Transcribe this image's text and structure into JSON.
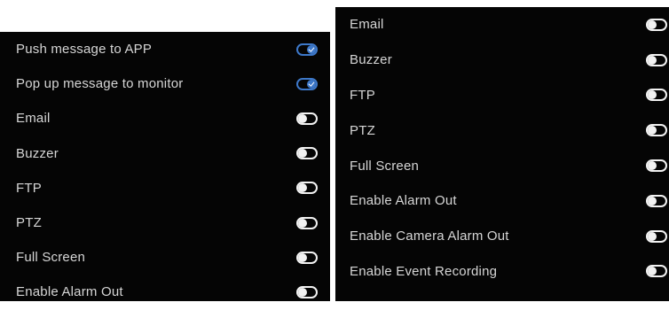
{
  "left_panel": {
    "items": [
      {
        "label": "Push message to APP",
        "enabled": true
      },
      {
        "label": "Pop up message to monitor",
        "enabled": true
      },
      {
        "label": "Email",
        "enabled": false
      },
      {
        "label": "Buzzer",
        "enabled": false
      },
      {
        "label": "FTP",
        "enabled": false
      },
      {
        "label": "PTZ",
        "enabled": false
      },
      {
        "label": "Full Screen",
        "enabled": false
      },
      {
        "label": "Enable Alarm Out",
        "enabled": false
      }
    ]
  },
  "right_panel": {
    "items": [
      {
        "label": "Email",
        "enabled": false
      },
      {
        "label": "Buzzer",
        "enabled": false
      },
      {
        "label": "FTP",
        "enabled": false
      },
      {
        "label": "PTZ",
        "enabled": false
      },
      {
        "label": "Full Screen",
        "enabled": false
      },
      {
        "label": "Enable Alarm Out",
        "enabled": false
      },
      {
        "label": "Enable Camera Alarm Out",
        "enabled": false
      },
      {
        "label": "Enable Event Recording",
        "enabled": false
      }
    ]
  },
  "colors": {
    "panel_background": "#050505",
    "text": "#d6d6d6",
    "toggle_on": "#3d78c9",
    "toggle_off": "#f2f2f2"
  }
}
